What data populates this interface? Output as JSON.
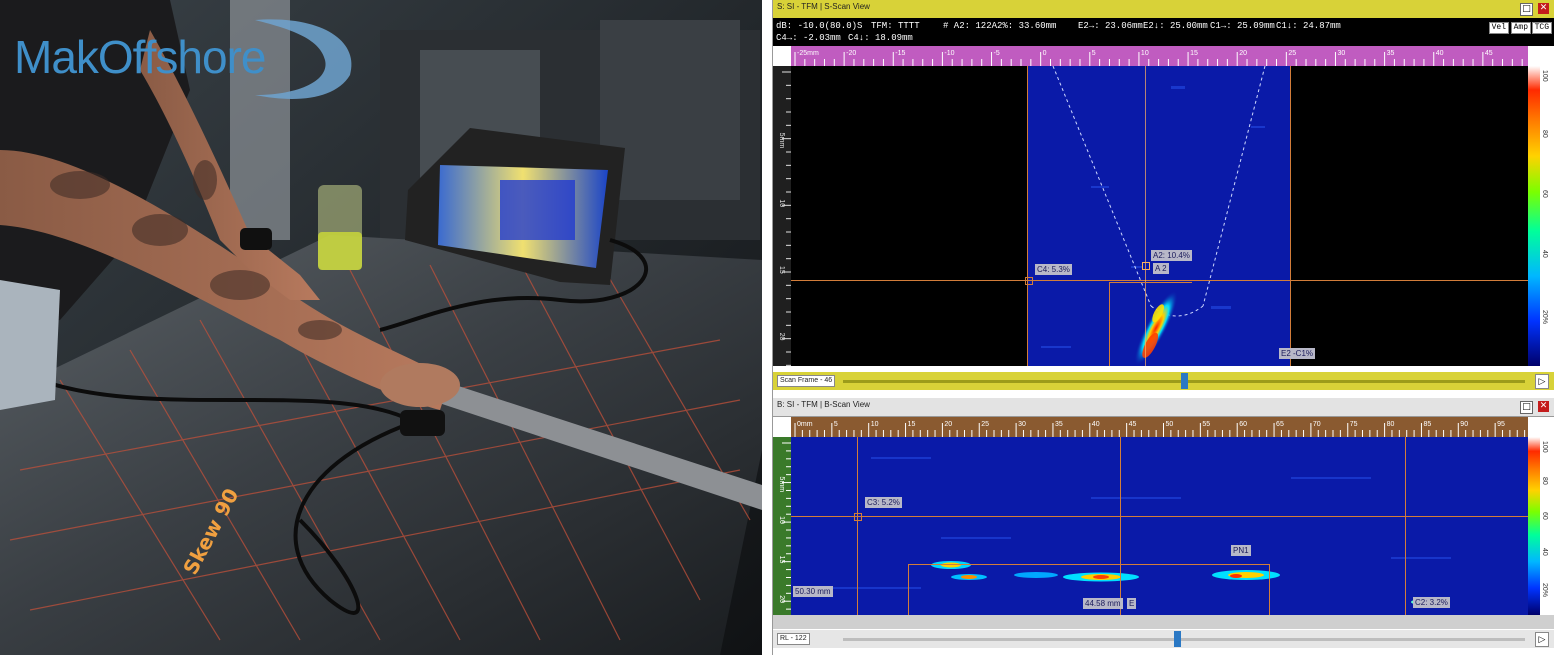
{
  "brand": {
    "logo_text": "MakOffshore"
  },
  "photo": {
    "marker_text": "Skew 90"
  },
  "sscan": {
    "window_title": "S: SI - TFM | S-Scan View",
    "readouts": {
      "db": "dB: -10.0(80.0)S",
      "tfm": "TFM: TTTT",
      "a2": "# A2: 122A2%: 33.60mm",
      "e2": "E2→: 23.06mm",
      "e2b": "E2↓: 25.00mm",
      "c1": "C1→: 25.09mm",
      "c1b": "C1↓: 24.87mm",
      "c4": "C4→: -2.03mm",
      "c4b": "C4↓: 18.09mm"
    },
    "buttons": {
      "vel": "Vel",
      "amp": "Amp",
      "tcg": "TCG"
    },
    "ruler_labels": [
      "-25mm",
      "-20",
      "-15",
      "-10",
      "-5",
      "0",
      "5",
      "10",
      "15",
      "20",
      "25",
      "30",
      "35",
      "40",
      "45"
    ],
    "depth_labels": [
      "5mm",
      "10",
      "15",
      "20"
    ],
    "colorbar_labels": [
      "100",
      "80",
      "60",
      "40",
      "20%"
    ],
    "cursor_labels": {
      "c4": "C4: 5.3%",
      "a2": "A2: 10.4%",
      "a2b": "A 2",
      "e2": "E2 -C1%"
    },
    "slider": {
      "name": "Scan Frame - 46",
      "position": 0.5
    }
  },
  "bscan": {
    "window_title": "B: SI - TFM | B-Scan View",
    "ruler_labels": [
      "0mm",
      "5",
      "10",
      "15",
      "20",
      "25",
      "30",
      "35",
      "40",
      "45",
      "50",
      "55",
      "60",
      "65",
      "70",
      "75",
      "80",
      "85",
      "90",
      "95"
    ],
    "depth_labels": [
      "5mm",
      "10",
      "15",
      "20"
    ],
    "colorbar_labels": [
      "100",
      "80",
      "60",
      "40",
      "20%"
    ],
    "cursor_labels": {
      "c3": "C3: 5.2%",
      "pn1": "PN1",
      "depth": "50.30 mm",
      "pos": "44.58 mm",
      "e": "E",
      "c2": "C2: 3.2%"
    },
    "slider": {
      "name": "RL - 122",
      "position": 0.49
    }
  },
  "colors": {
    "accent": "#d8d238",
    "close": "#c41c1c",
    "cursor": "#d27d3a",
    "scan_bg": "#0a1aa8"
  }
}
